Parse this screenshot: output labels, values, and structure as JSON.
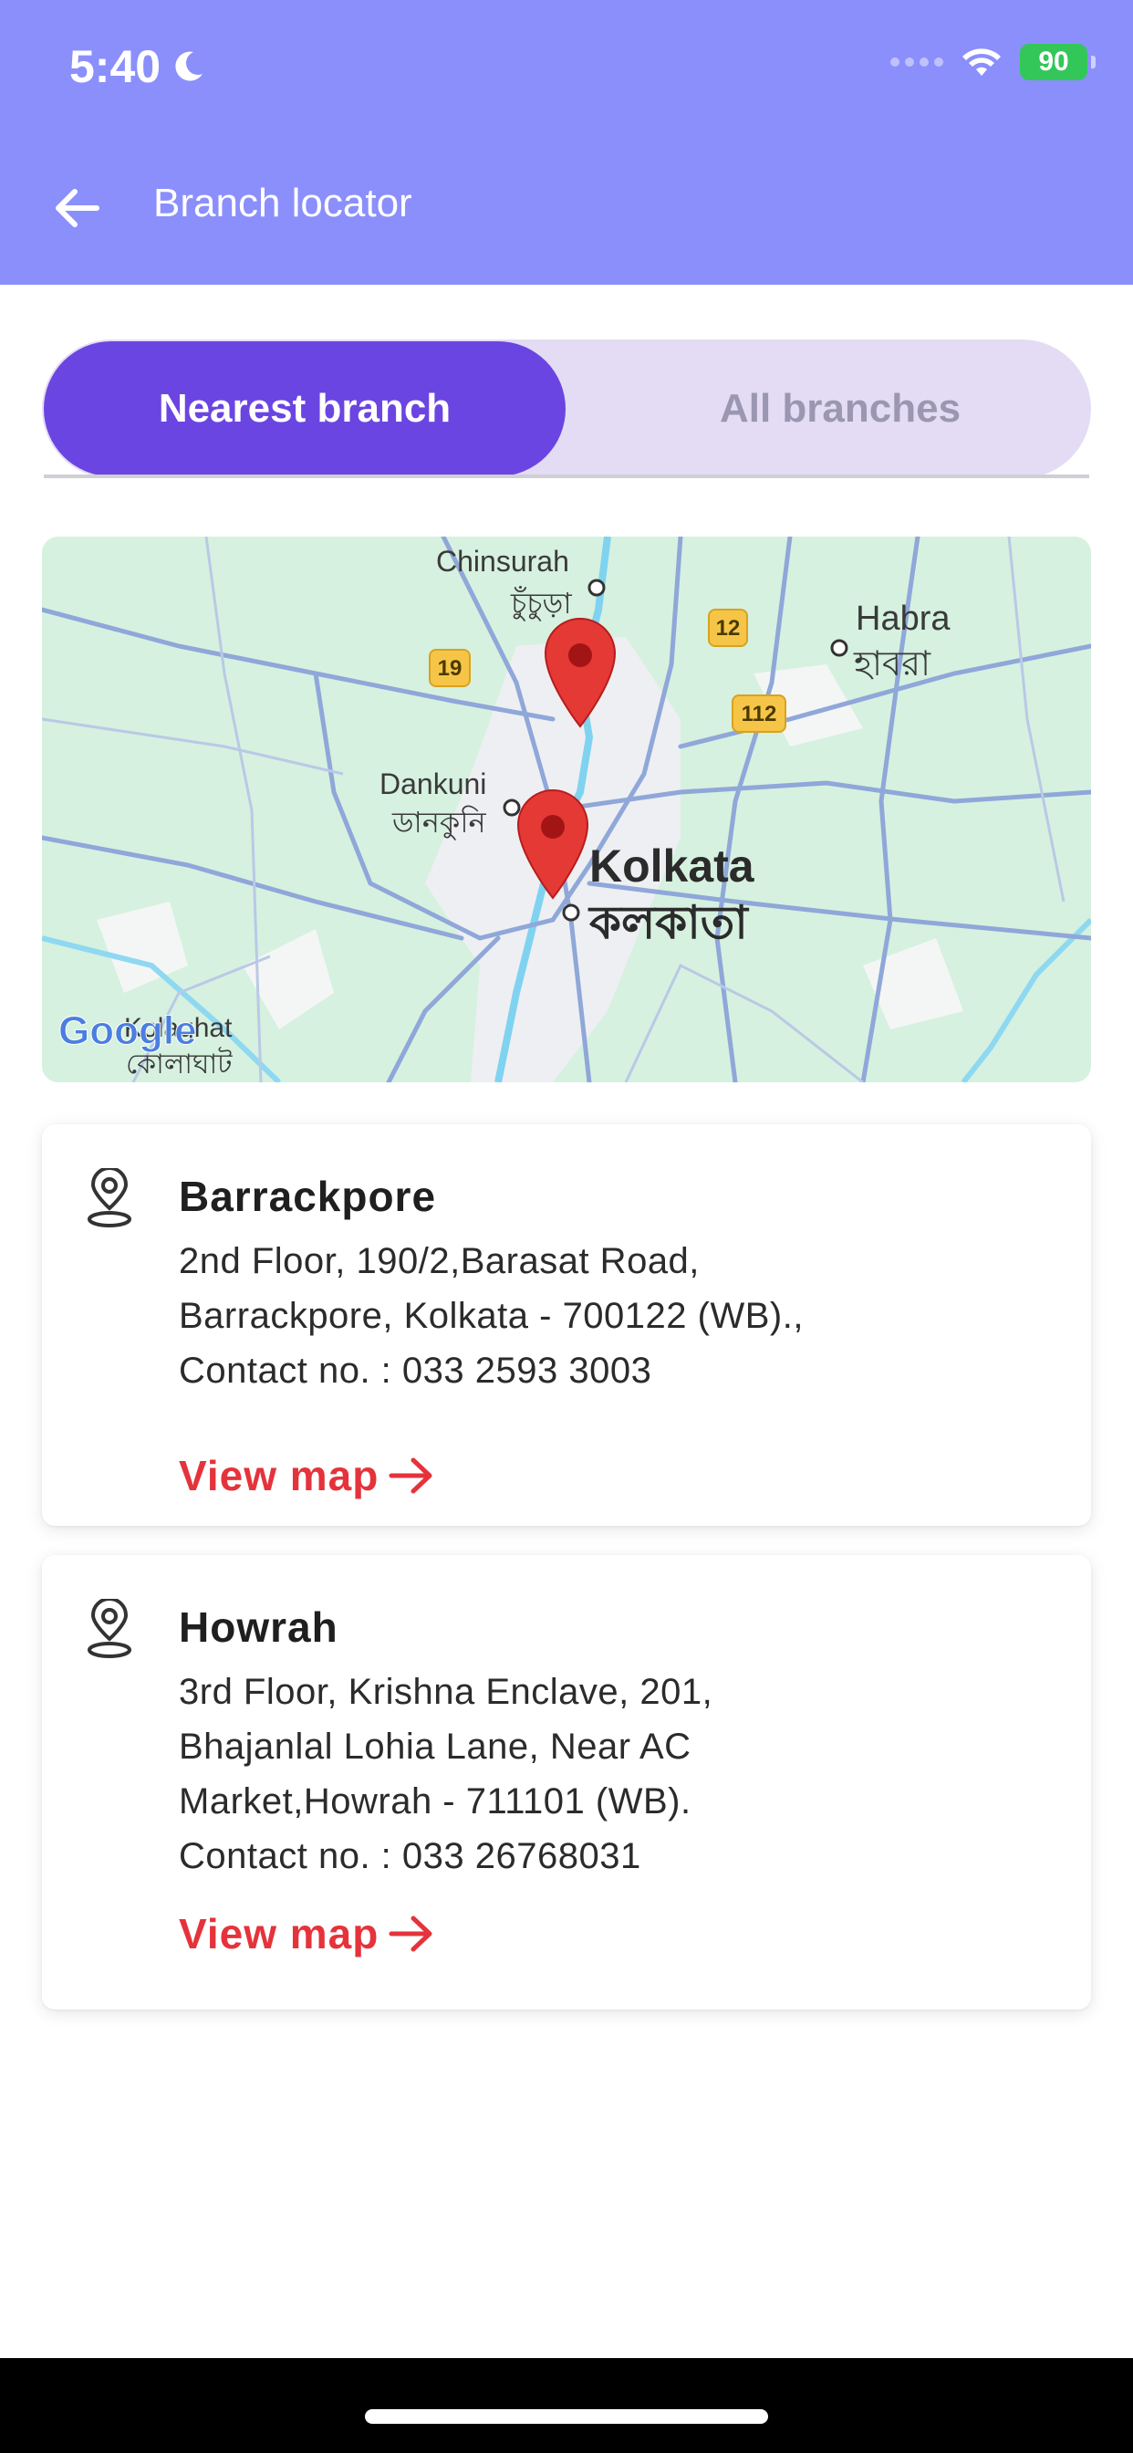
{
  "status_bar": {
    "time": "5:40",
    "battery": "90"
  },
  "header": {
    "title": "Branch locator"
  },
  "tabs": [
    {
      "label": "Nearest branch",
      "active": true
    },
    {
      "label": "All branches",
      "active": false
    }
  ],
  "map": {
    "labels": {
      "chinsurah": "Chinsurah",
      "chinsurah_bn": "চুঁচুড়া",
      "habra": "Habra",
      "habra_bn": "হাবরা",
      "dankuni": "Dankuni",
      "dankuni_bn": "ডানকুনি",
      "kolkata": "Kolkata",
      "kolkata_bn": "কলকাতা",
      "kolaghat": "Kolaghat",
      "kolaghat_bn": "কোলাঘাট",
      "route_19": "19",
      "route_12": "12",
      "route_112": "112"
    },
    "attribution": "Google"
  },
  "branches": [
    {
      "name": "Barrackpore",
      "lines": [
        "2nd Floor, 190/2,Barasat Road,",
        "Barrackpore, Kolkata - 700122 (WB).,",
        "Contact no. : 033 2593 3003"
      ],
      "link": "View map"
    },
    {
      "name": "Howrah",
      "lines": [
        "3rd Floor, Krishna Enclave, 201,",
        "Bhajanlal Lohia Lane, Near AC",
        "Market,Howrah - 711101 (WB).",
        "Contact no. : 033 26768031"
      ],
      "link": "View map"
    }
  ],
  "colors": {
    "header": "#8b8ffc",
    "accent": "#6b45e1",
    "tab_inactive_bg": "#e3dcf4",
    "link": "#e5333b",
    "marker": "#e53935"
  }
}
